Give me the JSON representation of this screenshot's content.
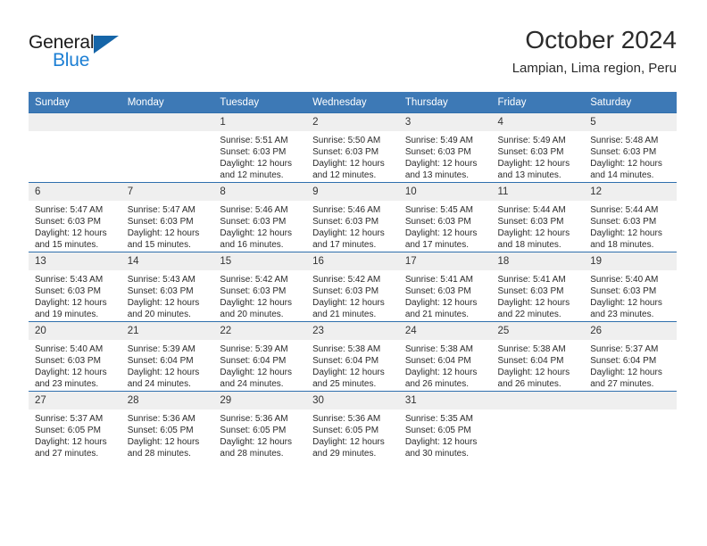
{
  "brand": {
    "name_part1": "General",
    "name_part2": "Blue",
    "accent_color": "#1c7fd4",
    "triangle_color": "#1565a8"
  },
  "header": {
    "month_title": "October 2024",
    "location": "Lampian, Lima region, Peru"
  },
  "calendar": {
    "header_bg": "#3d79b6",
    "daynum_bg": "#efefef",
    "weekday_headers": [
      "Sunday",
      "Monday",
      "Tuesday",
      "Wednesday",
      "Thursday",
      "Friday",
      "Saturday"
    ],
    "weeks": [
      [
        {
          "day": "",
          "sunrise": "",
          "sunset": "",
          "daylight_line1": "",
          "daylight_line2": ""
        },
        {
          "day": "",
          "sunrise": "",
          "sunset": "",
          "daylight_line1": "",
          "daylight_line2": ""
        },
        {
          "day": "1",
          "sunrise": "Sunrise: 5:51 AM",
          "sunset": "Sunset: 6:03 PM",
          "daylight_line1": "Daylight: 12 hours",
          "daylight_line2": "and 12 minutes."
        },
        {
          "day": "2",
          "sunrise": "Sunrise: 5:50 AM",
          "sunset": "Sunset: 6:03 PM",
          "daylight_line1": "Daylight: 12 hours",
          "daylight_line2": "and 12 minutes."
        },
        {
          "day": "3",
          "sunrise": "Sunrise: 5:49 AM",
          "sunset": "Sunset: 6:03 PM",
          "daylight_line1": "Daylight: 12 hours",
          "daylight_line2": "and 13 minutes."
        },
        {
          "day": "4",
          "sunrise": "Sunrise: 5:49 AM",
          "sunset": "Sunset: 6:03 PM",
          "daylight_line1": "Daylight: 12 hours",
          "daylight_line2": "and 13 minutes."
        },
        {
          "day": "5",
          "sunrise": "Sunrise: 5:48 AM",
          "sunset": "Sunset: 6:03 PM",
          "daylight_line1": "Daylight: 12 hours",
          "daylight_line2": "and 14 minutes."
        }
      ],
      [
        {
          "day": "6",
          "sunrise": "Sunrise: 5:47 AM",
          "sunset": "Sunset: 6:03 PM",
          "daylight_line1": "Daylight: 12 hours",
          "daylight_line2": "and 15 minutes."
        },
        {
          "day": "7",
          "sunrise": "Sunrise: 5:47 AM",
          "sunset": "Sunset: 6:03 PM",
          "daylight_line1": "Daylight: 12 hours",
          "daylight_line2": "and 15 minutes."
        },
        {
          "day": "8",
          "sunrise": "Sunrise: 5:46 AM",
          "sunset": "Sunset: 6:03 PM",
          "daylight_line1": "Daylight: 12 hours",
          "daylight_line2": "and 16 minutes."
        },
        {
          "day": "9",
          "sunrise": "Sunrise: 5:46 AM",
          "sunset": "Sunset: 6:03 PM",
          "daylight_line1": "Daylight: 12 hours",
          "daylight_line2": "and 17 minutes."
        },
        {
          "day": "10",
          "sunrise": "Sunrise: 5:45 AM",
          "sunset": "Sunset: 6:03 PM",
          "daylight_line1": "Daylight: 12 hours",
          "daylight_line2": "and 17 minutes."
        },
        {
          "day": "11",
          "sunrise": "Sunrise: 5:44 AM",
          "sunset": "Sunset: 6:03 PM",
          "daylight_line1": "Daylight: 12 hours",
          "daylight_line2": "and 18 minutes."
        },
        {
          "day": "12",
          "sunrise": "Sunrise: 5:44 AM",
          "sunset": "Sunset: 6:03 PM",
          "daylight_line1": "Daylight: 12 hours",
          "daylight_line2": "and 18 minutes."
        }
      ],
      [
        {
          "day": "13",
          "sunrise": "Sunrise: 5:43 AM",
          "sunset": "Sunset: 6:03 PM",
          "daylight_line1": "Daylight: 12 hours",
          "daylight_line2": "and 19 minutes."
        },
        {
          "day": "14",
          "sunrise": "Sunrise: 5:43 AM",
          "sunset": "Sunset: 6:03 PM",
          "daylight_line1": "Daylight: 12 hours",
          "daylight_line2": "and 20 minutes."
        },
        {
          "day": "15",
          "sunrise": "Sunrise: 5:42 AM",
          "sunset": "Sunset: 6:03 PM",
          "daylight_line1": "Daylight: 12 hours",
          "daylight_line2": "and 20 minutes."
        },
        {
          "day": "16",
          "sunrise": "Sunrise: 5:42 AM",
          "sunset": "Sunset: 6:03 PM",
          "daylight_line1": "Daylight: 12 hours",
          "daylight_line2": "and 21 minutes."
        },
        {
          "day": "17",
          "sunrise": "Sunrise: 5:41 AM",
          "sunset": "Sunset: 6:03 PM",
          "daylight_line1": "Daylight: 12 hours",
          "daylight_line2": "and 21 minutes."
        },
        {
          "day": "18",
          "sunrise": "Sunrise: 5:41 AM",
          "sunset": "Sunset: 6:03 PM",
          "daylight_line1": "Daylight: 12 hours",
          "daylight_line2": "and 22 minutes."
        },
        {
          "day": "19",
          "sunrise": "Sunrise: 5:40 AM",
          "sunset": "Sunset: 6:03 PM",
          "daylight_line1": "Daylight: 12 hours",
          "daylight_line2": "and 23 minutes."
        }
      ],
      [
        {
          "day": "20",
          "sunrise": "Sunrise: 5:40 AM",
          "sunset": "Sunset: 6:03 PM",
          "daylight_line1": "Daylight: 12 hours",
          "daylight_line2": "and 23 minutes."
        },
        {
          "day": "21",
          "sunrise": "Sunrise: 5:39 AM",
          "sunset": "Sunset: 6:04 PM",
          "daylight_line1": "Daylight: 12 hours",
          "daylight_line2": "and 24 minutes."
        },
        {
          "day": "22",
          "sunrise": "Sunrise: 5:39 AM",
          "sunset": "Sunset: 6:04 PM",
          "daylight_line1": "Daylight: 12 hours",
          "daylight_line2": "and 24 minutes."
        },
        {
          "day": "23",
          "sunrise": "Sunrise: 5:38 AM",
          "sunset": "Sunset: 6:04 PM",
          "daylight_line1": "Daylight: 12 hours",
          "daylight_line2": "and 25 minutes."
        },
        {
          "day": "24",
          "sunrise": "Sunrise: 5:38 AM",
          "sunset": "Sunset: 6:04 PM",
          "daylight_line1": "Daylight: 12 hours",
          "daylight_line2": "and 26 minutes."
        },
        {
          "day": "25",
          "sunrise": "Sunrise: 5:38 AM",
          "sunset": "Sunset: 6:04 PM",
          "daylight_line1": "Daylight: 12 hours",
          "daylight_line2": "and 26 minutes."
        },
        {
          "day": "26",
          "sunrise": "Sunrise: 5:37 AM",
          "sunset": "Sunset: 6:04 PM",
          "daylight_line1": "Daylight: 12 hours",
          "daylight_line2": "and 27 minutes."
        }
      ],
      [
        {
          "day": "27",
          "sunrise": "Sunrise: 5:37 AM",
          "sunset": "Sunset: 6:05 PM",
          "daylight_line1": "Daylight: 12 hours",
          "daylight_line2": "and 27 minutes."
        },
        {
          "day": "28",
          "sunrise": "Sunrise: 5:36 AM",
          "sunset": "Sunset: 6:05 PM",
          "daylight_line1": "Daylight: 12 hours",
          "daylight_line2": "and 28 minutes."
        },
        {
          "day": "29",
          "sunrise": "Sunrise: 5:36 AM",
          "sunset": "Sunset: 6:05 PM",
          "daylight_line1": "Daylight: 12 hours",
          "daylight_line2": "and 28 minutes."
        },
        {
          "day": "30",
          "sunrise": "Sunrise: 5:36 AM",
          "sunset": "Sunset: 6:05 PM",
          "daylight_line1": "Daylight: 12 hours",
          "daylight_line2": "and 29 minutes."
        },
        {
          "day": "31",
          "sunrise": "Sunrise: 5:35 AM",
          "sunset": "Sunset: 6:05 PM",
          "daylight_line1": "Daylight: 12 hours",
          "daylight_line2": "and 30 minutes."
        },
        {
          "day": "",
          "sunrise": "",
          "sunset": "",
          "daylight_line1": "",
          "daylight_line2": ""
        },
        {
          "day": "",
          "sunrise": "",
          "sunset": "",
          "daylight_line1": "",
          "daylight_line2": ""
        }
      ]
    ]
  }
}
